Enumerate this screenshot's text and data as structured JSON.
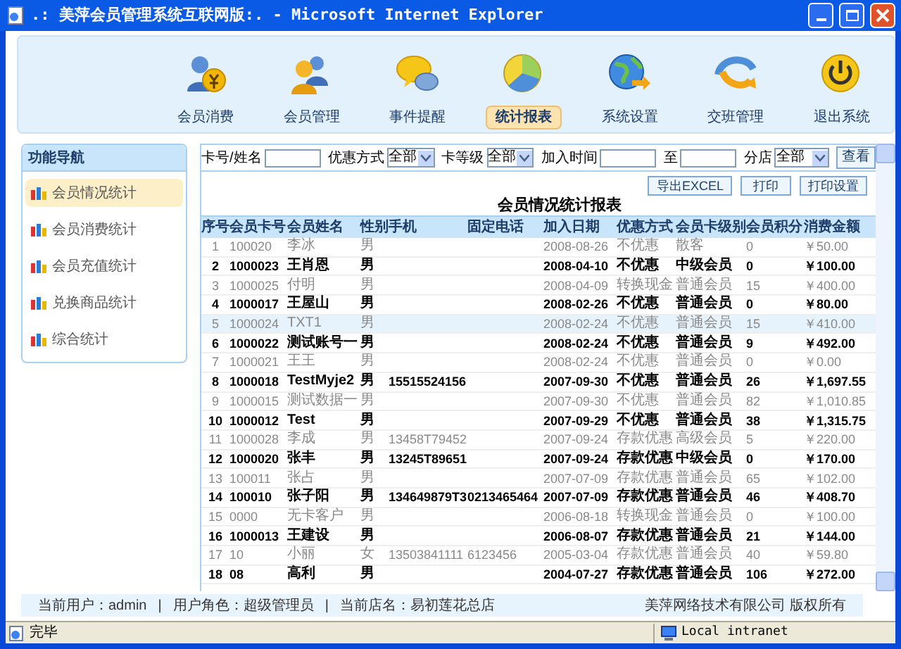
{
  "window": {
    "title": ".: 美萍会员管理系统互联网版:. - Microsoft Internet Explorer"
  },
  "nav": [
    {
      "label": "会员消费",
      "selected": false
    },
    {
      "label": "会员管理",
      "selected": false
    },
    {
      "label": "事件提醒",
      "selected": false
    },
    {
      "label": "统计报表",
      "selected": true
    },
    {
      "label": "系统设置",
      "selected": false
    },
    {
      "label": "交班管理",
      "selected": false
    },
    {
      "label": "退出系统",
      "selected": false
    }
  ],
  "sidebar": {
    "title": "功能导航",
    "items": [
      {
        "label": "会员情况统计",
        "selected": true
      },
      {
        "label": "会员消费统计",
        "selected": false
      },
      {
        "label": "会员充值统计",
        "selected": false
      },
      {
        "label": "兑换商品统计",
        "selected": false
      },
      {
        "label": "综合统计",
        "selected": false
      }
    ]
  },
  "filters": [
    {
      "kind": "text",
      "label": "卡号/姓名"
    },
    {
      "kind": "select",
      "label": "优惠方式",
      "value": "全部"
    },
    {
      "kind": "select",
      "label": "卡等级",
      "value": "全部"
    },
    {
      "kind": "text",
      "label": "加入时间"
    },
    {
      "kind": "text",
      "label": "至"
    },
    {
      "kind": "select",
      "label": "分店",
      "value": "全部"
    }
  ],
  "search_button": "查看",
  "actions": [
    "导出EXCEL",
    "打印",
    "打印设置"
  ],
  "report_title": "会员情况统计报表",
  "table": {
    "columns": [
      "序号",
      "会员卡号",
      "会员姓名",
      "性别",
      "手机",
      "固定电话",
      "加入日期",
      "优惠方式",
      "会员卡级别",
      "会员积分",
      "消费金额"
    ],
    "rows": [
      {
        "bold": false,
        "selected": false,
        "cells": [
          "1",
          "100020",
          "李冰",
          "男",
          "",
          "",
          "2008-08-26",
          "不优惠",
          "散客",
          "0",
          "￥50.00"
        ]
      },
      {
        "bold": true,
        "selected": false,
        "cells": [
          "2",
          "1000023",
          "王肖恩",
          "男",
          "",
          "",
          "2008-04-10",
          "不优惠",
          "中级会员",
          "0",
          "￥100.00"
        ]
      },
      {
        "bold": false,
        "selected": false,
        "cells": [
          "3",
          "1000025",
          "付明",
          "男",
          "",
          "",
          "2008-04-09",
          "转换现金",
          "普通会员",
          "15",
          "￥400.00"
        ]
      },
      {
        "bold": true,
        "selected": false,
        "cells": [
          "4",
          "1000017",
          "王屋山",
          "男",
          "",
          "",
          "2008-02-26",
          "不优惠",
          "普通会员",
          "0",
          "￥80.00"
        ]
      },
      {
        "bold": false,
        "selected": true,
        "cells": [
          "5",
          "1000024",
          "TXT1",
          "男",
          "",
          "",
          "2008-02-24",
          "不优惠",
          "普通会员",
          "15",
          "￥410.00"
        ]
      },
      {
        "bold": true,
        "selected": false,
        "cells": [
          "6",
          "1000022",
          "测试账号一",
          "男",
          "",
          "",
          "2008-02-24",
          "不优惠",
          "普通会员",
          "9",
          "￥492.00"
        ]
      },
      {
        "bold": false,
        "selected": false,
        "cells": [
          "7",
          "1000021",
          "王王",
          "男",
          "",
          "",
          "2008-02-24",
          "不优惠",
          "普通会员",
          "0",
          "￥0.00"
        ]
      },
      {
        "bold": true,
        "selected": false,
        "cells": [
          "8",
          "1000018",
          "TestMyje2",
          "男",
          "15515524156",
          "",
          "2007-09-30",
          "不优惠",
          "普通会员",
          "26",
          "￥1,697.55"
        ]
      },
      {
        "bold": false,
        "selected": false,
        "cells": [
          "9",
          "1000015",
          "测试数据一",
          "男",
          "",
          "",
          "2007-09-30",
          "不优惠",
          "普通会员",
          "82",
          "￥1,010.85"
        ]
      },
      {
        "bold": true,
        "selected": false,
        "cells": [
          "10",
          "1000012",
          "Test",
          "男",
          "",
          "",
          "2007-09-29",
          "不优惠",
          "普通会员",
          "38",
          "￥1,315.75"
        ]
      },
      {
        "bold": false,
        "selected": false,
        "cells": [
          "11",
          "1000028",
          "李成",
          "男",
          "13458T79452",
          "",
          "2007-09-24",
          "存款优惠",
          "高级会员",
          "5",
          "￥220.00"
        ]
      },
      {
        "bold": true,
        "selected": false,
        "cells": [
          "12",
          "1000020",
          "张丰",
          "男",
          "13245T89651",
          "",
          "2007-09-24",
          "存款优惠",
          "中级会员",
          "0",
          "￥170.00"
        ]
      },
      {
        "bold": false,
        "selected": false,
        "cells": [
          "13",
          "100011",
          "张占",
          "男",
          "",
          "",
          "2007-07-09",
          "存款优惠",
          "普通会员",
          "65",
          "￥102.00"
        ]
      },
      {
        "bold": true,
        "selected": false,
        "cells": [
          "14",
          "100010",
          "张子阳",
          "男",
          "134649879T3",
          "0213465464",
          "2007-07-09",
          "存款优惠",
          "普通会员",
          "46",
          "￥408.70"
        ]
      },
      {
        "bold": false,
        "selected": false,
        "cells": [
          "15",
          "0000",
          "无卡客户",
          "男",
          "",
          "",
          "2006-08-18",
          "转换现金",
          "普通会员",
          "0",
          "￥100.00"
        ]
      },
      {
        "bold": true,
        "selected": false,
        "cells": [
          "16",
          "1000013",
          "王建设",
          "男",
          "",
          "",
          "2006-08-07",
          "存款优惠",
          "普通会员",
          "21",
          "￥144.00"
        ]
      },
      {
        "bold": false,
        "selected": false,
        "cells": [
          "17",
          "10",
          "小丽",
          "女",
          "13503841111",
          "6123456",
          "2005-03-04",
          "存款优惠",
          "普通会员",
          "40",
          "￥59.80"
        ]
      },
      {
        "bold": true,
        "selected": false,
        "cells": [
          "18",
          "08",
          "高利",
          "男",
          "",
          "",
          "2004-07-27",
          "存款优惠",
          "普通会员",
          "106",
          "￥272.00"
        ]
      }
    ]
  },
  "footer": {
    "items": [
      "当前用户：admin",
      "|",
      "用户角色：超级管理员",
      "|",
      "当前店名：易初莲花总店"
    ],
    "copyright": "美萍网络技术有限公司 版权所有"
  },
  "status_bar": {
    "text": "完毕",
    "zone": "Local intranet"
  }
}
